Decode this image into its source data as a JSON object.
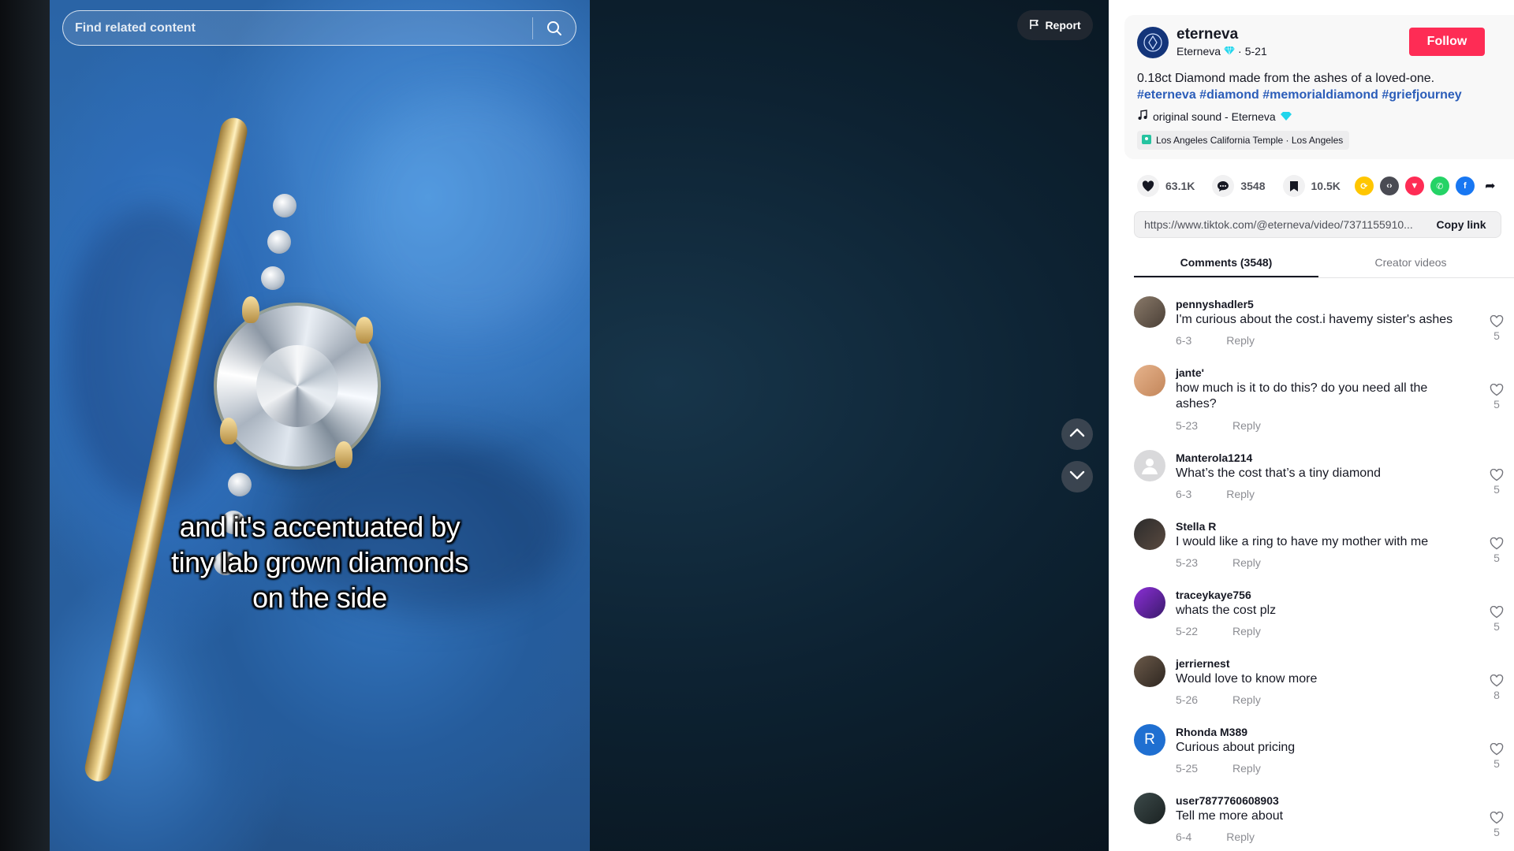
{
  "video": {
    "caption_lines": [
      "and it's accentuated by",
      "tiny lab grown diamonds",
      "on the side"
    ]
  },
  "search": {
    "placeholder": "Find related content"
  },
  "report_label": "Report",
  "author": {
    "handle": "eterneva",
    "display_name": "Eterneva",
    "date": "5-21",
    "follow_label": "Follow"
  },
  "post": {
    "description": "0.18ct Diamond made from the ashes of a loved-one.",
    "hashtags": [
      "#eterneva",
      "#diamond",
      "#memorialdiamond",
      "#griefjourney"
    ],
    "sound": "original sound - Eterneva",
    "location": "Los Angeles California Temple · Los Angeles"
  },
  "actions": {
    "likes": "63.1K",
    "comments": "3548",
    "saves": "10.5K"
  },
  "share": {
    "url": "https://www.tiktok.com/@eterneva/video/7371155910...",
    "copy_label": "Copy link"
  },
  "tabs": [
    {
      "label": "Comments (3548)",
      "active": true
    },
    {
      "label": "Creator videos",
      "active": false
    }
  ],
  "reply_label": "Reply",
  "comments": [
    {
      "user": "pennyshadler5",
      "text": "I'm curious about the cost.i havemy sister's ashes",
      "date": "6-3",
      "likes": "5"
    },
    {
      "user": "jante'",
      "text": "how much is it to do this? do you need all the ashes?",
      "date": "5-23",
      "likes": "5"
    },
    {
      "user": "Manterola1214",
      "text": "What’s the cost that’s a tiny diamond",
      "date": "6-3",
      "likes": "5"
    },
    {
      "user": "Stella R",
      "text": "I would like a ring to have my mother with me",
      "date": "5-23",
      "likes": "5"
    },
    {
      "user": "traceykaye756",
      "text": "whats the cost plz",
      "date": "5-22",
      "likes": "5"
    },
    {
      "user": "jerriernest",
      "text": "Would love to know more",
      "date": "5-26",
      "likes": "8"
    },
    {
      "user": "Rhonda M389",
      "text": "Curious about pricing",
      "date": "5-25",
      "likes": "5",
      "avatar_letter": "R"
    },
    {
      "user": "user7877760608903",
      "text": "Tell me more about",
      "date": "6-4",
      "likes": "5"
    }
  ],
  "colors": {
    "follow": "#fe2c55",
    "hashtag": "#2b5db9",
    "verified": "#20d5ec"
  }
}
